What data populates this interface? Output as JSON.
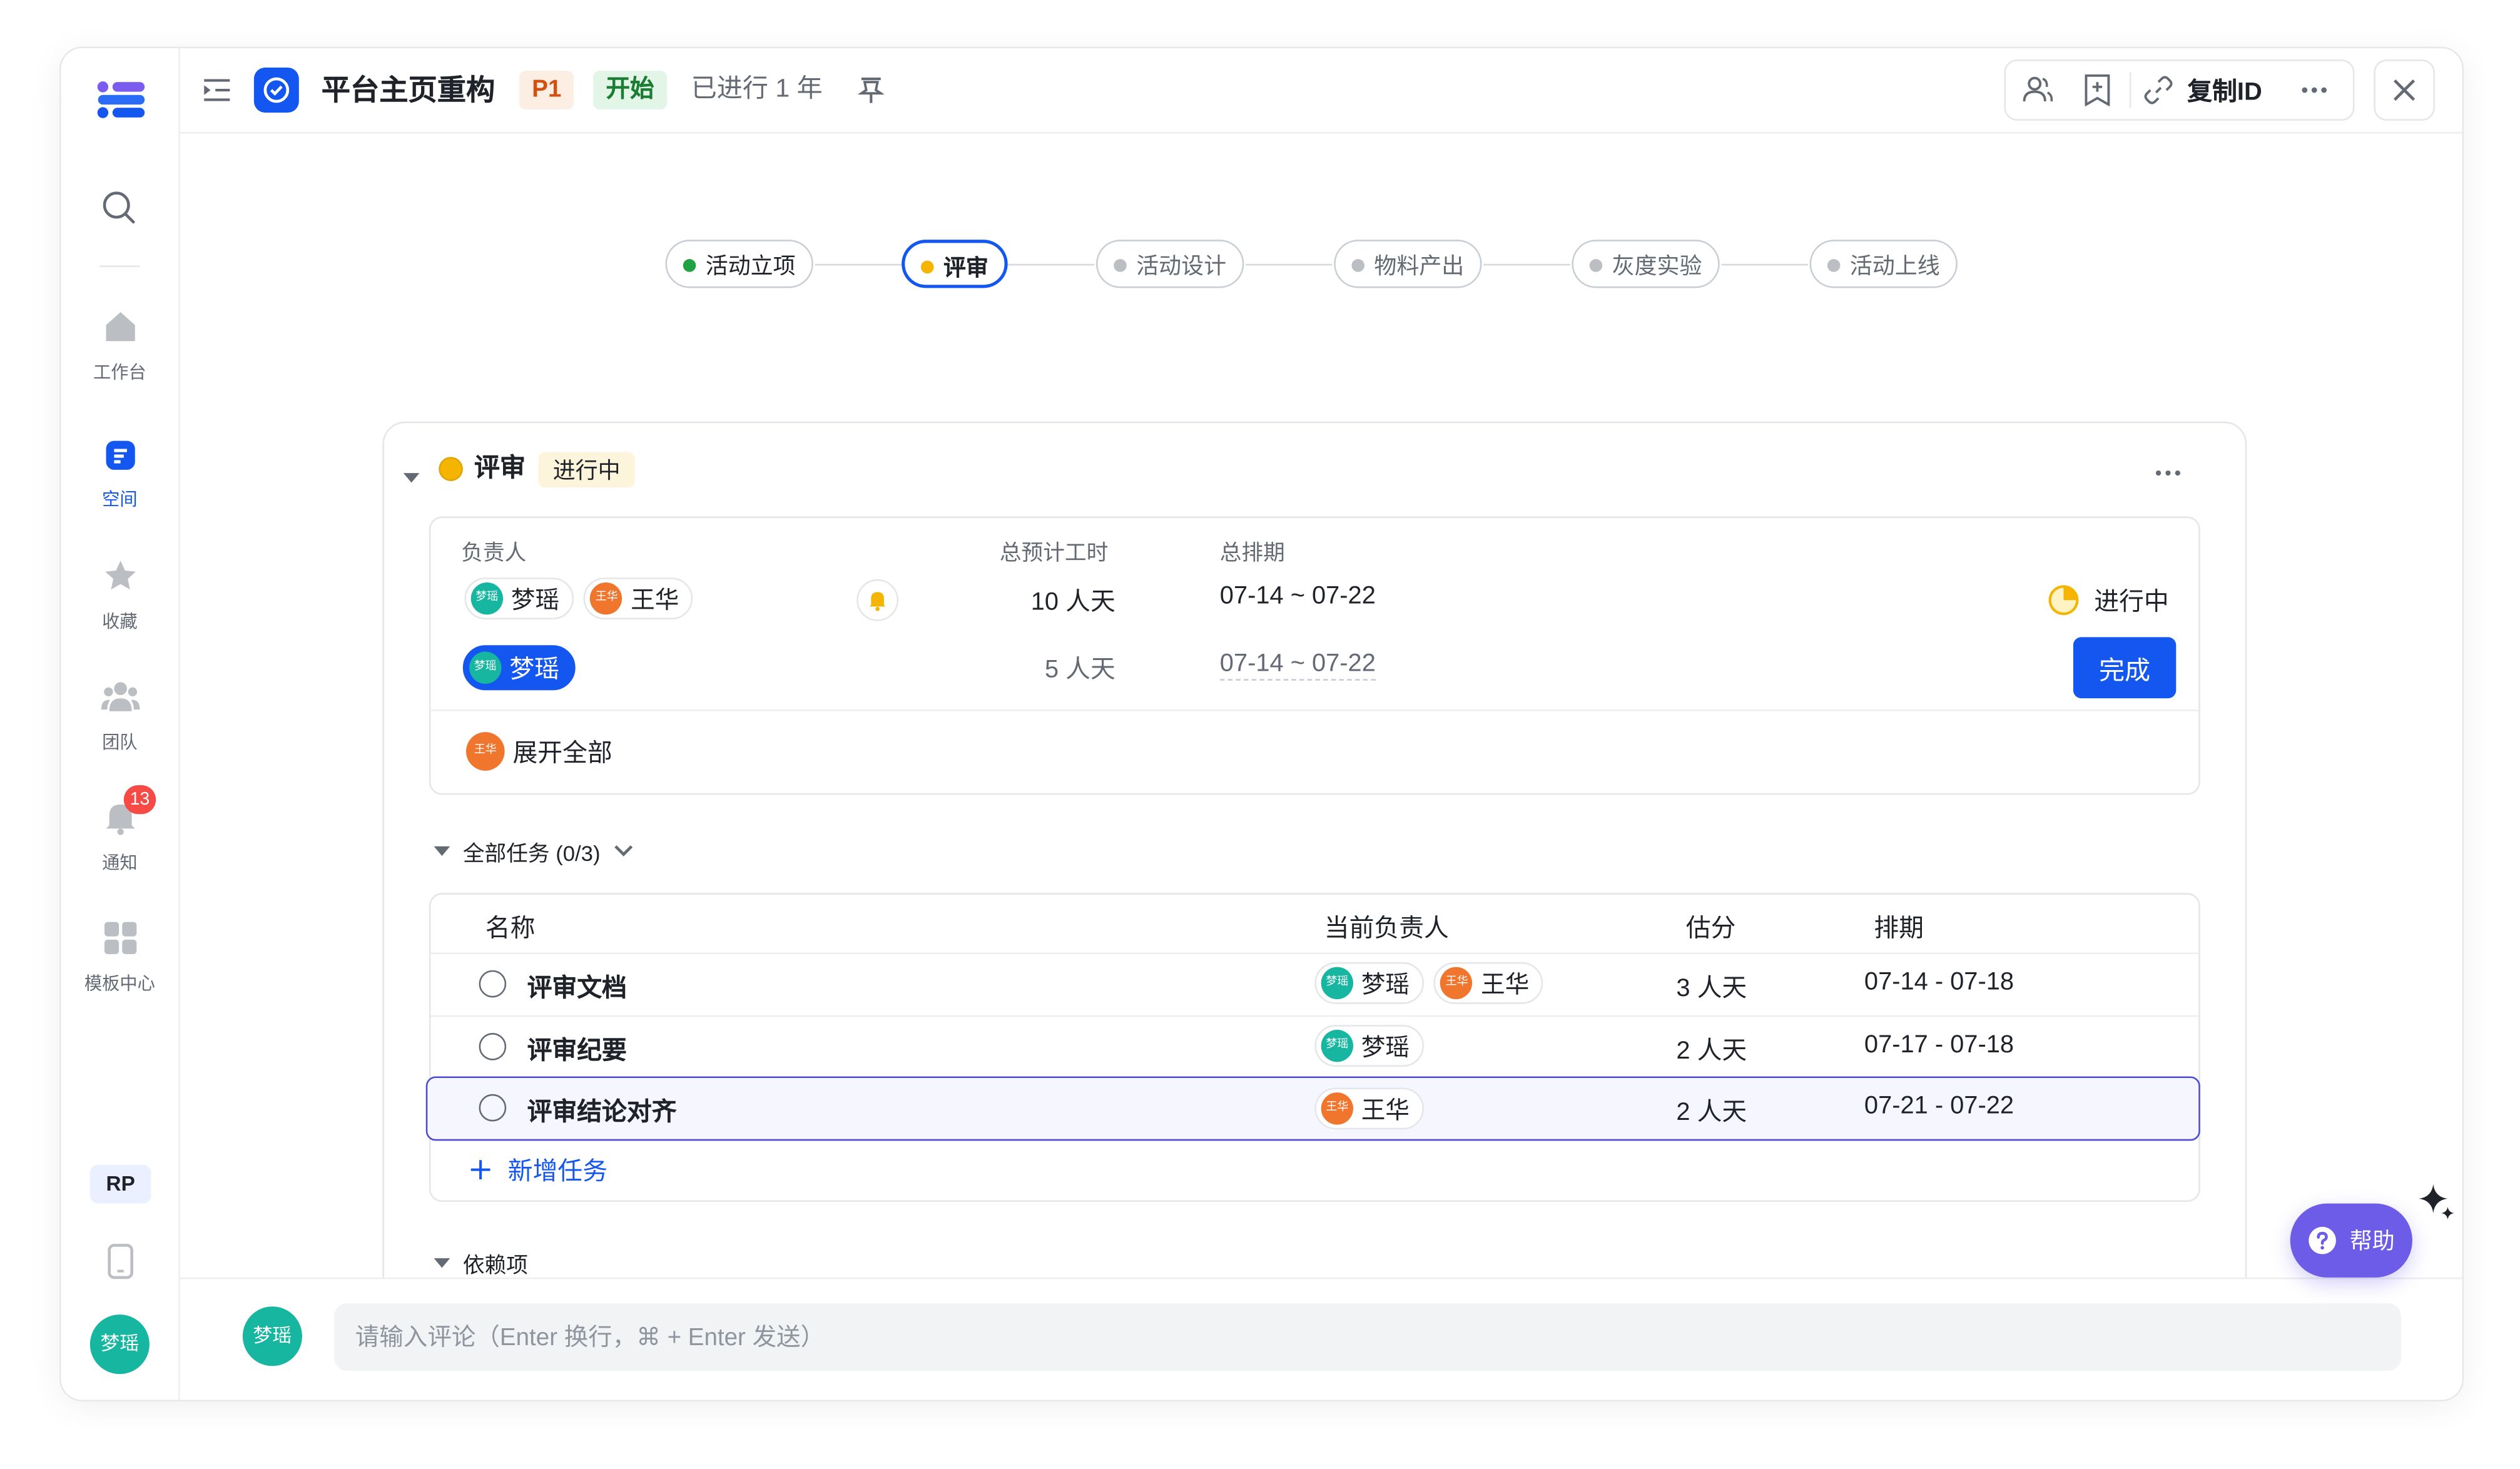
{
  "header": {
    "title": "平台主页重构",
    "priority": "P1",
    "status": "开始",
    "elapsed": "已进行 1 年",
    "copy_id_label": "复制ID"
  },
  "sidebar": {
    "items": [
      {
        "label": "工作台"
      },
      {
        "label": "空间"
      },
      {
        "label": "收藏"
      },
      {
        "label": "团队"
      },
      {
        "label": "通知",
        "badge": "13"
      },
      {
        "label": "模板中心"
      }
    ],
    "workspace_badge": "RP",
    "user_avatar": "梦瑶"
  },
  "pipeline": [
    {
      "label": "活动立项",
      "state": "done"
    },
    {
      "label": "评审",
      "state": "current"
    },
    {
      "label": "活动设计",
      "state": "pending"
    },
    {
      "label": "物料产出",
      "state": "pending"
    },
    {
      "label": "灰度实验",
      "state": "pending"
    },
    {
      "label": "活动上线",
      "state": "pending"
    }
  ],
  "node": {
    "title": "评审",
    "status": "进行中",
    "headers": {
      "owner": "负责人",
      "estimate": "总预计工时",
      "schedule": "总排期"
    },
    "summary": {
      "owners": [
        "梦瑶",
        "王华"
      ],
      "estimate": "10 人天",
      "schedule": "07-14 ~ 07-22",
      "state": "进行中"
    },
    "mine": {
      "owner": "梦瑶",
      "estimate": "5 人天",
      "schedule": "07-14 ~ 07-22",
      "action": "完成"
    },
    "expand_label": "展开全部",
    "expand_avatar": "王华"
  },
  "tasks": {
    "section_label": "全部任务 (0/3)",
    "columns": [
      "名称",
      "当前负责人",
      "估分",
      "排期"
    ],
    "rows": [
      {
        "name": "评审文档",
        "owners": [
          "梦瑶",
          "王华"
        ],
        "estimate": "3 人天",
        "schedule": "07-14 - 07-18"
      },
      {
        "name": "评审纪要",
        "owners": [
          "梦瑶"
        ],
        "estimate": "2 人天",
        "schedule": "07-17 - 07-18"
      },
      {
        "name": "评审结论对齐",
        "owners": [
          "王华"
        ],
        "estimate": "2 人天",
        "schedule": "07-21 - 07-22"
      }
    ],
    "add_label": "新增任务"
  },
  "deps_label": "依赖项",
  "comment": {
    "avatar": "梦瑶",
    "placeholder": "请输入评论（Enter 换行，⌘ + Enter 发送）"
  },
  "help_label": "帮助",
  "avatar_short": {
    "梦瑶": "梦瑶",
    "王华": "王华"
  },
  "colors": {
    "accent": "#1456f0",
    "in_progress": "#f5b400",
    "done": "#20a144",
    "help": "#6c5ce7"
  }
}
